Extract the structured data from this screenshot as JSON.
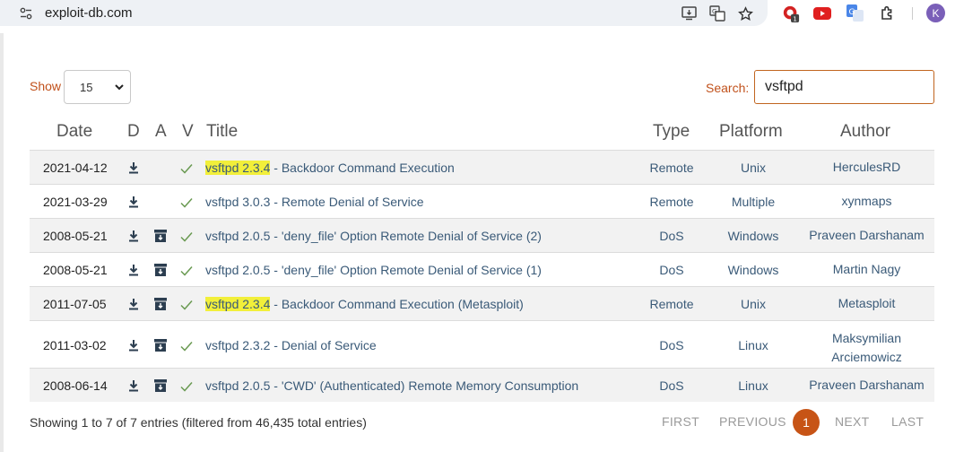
{
  "browser": {
    "url": "exploit-db.com",
    "avatar_letter": "K",
    "extension_badge": "1"
  },
  "controls": {
    "show_label": "Show",
    "show_value": "15",
    "search_label": "Search:",
    "search_value": "vsftpd"
  },
  "table": {
    "headers": {
      "date": "Date",
      "d": "D",
      "a": "A",
      "v": "V",
      "title": "Title",
      "type": "Type",
      "platform": "Platform",
      "author": "Author"
    },
    "rows": [
      {
        "date": "2021-04-12",
        "title_hl": "vsftpd 2.3.4",
        "title_rest": " - Backdoor Command Execution",
        "type": "Remote",
        "platform": "Unix",
        "author": "HerculesRD",
        "archive": false
      },
      {
        "date": "2021-03-29",
        "title_hl": "",
        "title_rest": "vsftpd 3.0.3 - Remote Denial of Service",
        "type": "Remote",
        "platform": "Multiple",
        "author": "xynmaps",
        "archive": false
      },
      {
        "date": "2008-05-21",
        "title_hl": "",
        "title_rest": "vsftpd 2.0.5 - 'deny_file' Option Remote Denial of Service (2)",
        "type": "DoS",
        "platform": "Windows",
        "author": "Praveen Darshanam",
        "archive": true
      },
      {
        "date": "2008-05-21",
        "title_hl": "",
        "title_rest": "vsftpd 2.0.5 - 'deny_file' Option Remote Denial of Service (1)",
        "type": "DoS",
        "platform": "Windows",
        "author": "Martin Nagy",
        "archive": true
      },
      {
        "date": "2011-07-05",
        "title_hl": "vsftpd 2.3.4",
        "title_rest": " - Backdoor Command Execution (Metasploit)",
        "type": "Remote",
        "platform": "Unix",
        "author": "Metasploit",
        "archive": true
      },
      {
        "date": "2011-03-02",
        "title_hl": "",
        "title_rest": "vsftpd 2.3.2 - Denial of Service",
        "type": "DoS",
        "platform": "Linux",
        "author_line1": "Maksymilian",
        "author_line2": "Arciemowicz",
        "archive": true
      },
      {
        "date": "2008-06-14",
        "title_hl": "",
        "title_rest": "vsftpd 2.0.5 - 'CWD' (Authenticated) Remote Memory Consumption",
        "type": "DoS",
        "platform": "Linux",
        "author": "Praveen Darshanam",
        "archive": true
      }
    ]
  },
  "footer": {
    "info": "Showing 1 to 7 of 7 entries (filtered from 46,435 total entries)",
    "first": "FIRST",
    "previous": "PREVIOUS",
    "current_page": "1",
    "next": "NEXT",
    "last": "LAST"
  },
  "colors": {
    "accent": "#c75416",
    "link": "#3a5a78",
    "highlight": "#f2ef3a",
    "check": "#6a9a52"
  }
}
